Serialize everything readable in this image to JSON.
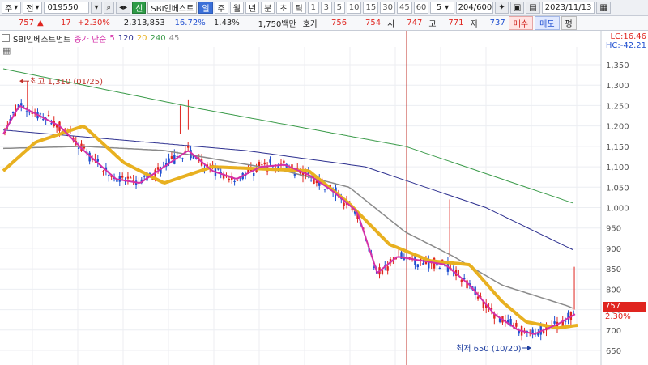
{
  "toolbar": {
    "market_label": "주",
    "prev_label": "전",
    "code": "019550",
    "tag_credit": "신",
    "stock_name": "SBI인베스트",
    "periods": [
      "일",
      "주",
      "월",
      "년",
      "분",
      "초",
      "틱"
    ],
    "period_selected": "일",
    "minute_steps": [
      "1",
      "3",
      "5",
      "10",
      "15",
      "30",
      "45",
      "60"
    ],
    "interval_value": "5",
    "count_value": "204",
    "count_total": "/600",
    "date_value": "2023/11/13"
  },
  "quote": {
    "price": "757",
    "change_arrow": "▲",
    "change": "17",
    "change_pct": "+2.30%",
    "volume": "2,313,853",
    "volume_pct": "16.72%",
    "turnover_pct": "1.43%",
    "amount": "1,750백만",
    "ask_label": "호가",
    "ask1": "756",
    "ask2": "754",
    "open_label": "시",
    "open": "747",
    "high_label": "고",
    "high": "771",
    "low_label": "저",
    "low": "737",
    "buy_label": "매수",
    "sell_label": "매도",
    "eval_label": "평"
  },
  "legend": {
    "name": "SBI인베스트먼트",
    "ma_type": "종가 단순",
    "ma5": "5",
    "ma20": "20",
    "ma120": "120",
    "ma240": "240",
    "ma45": "45"
  },
  "right_info": {
    "lc": "LC:16.46",
    "hc": "HC:-42.21",
    "current_price_tag": "757",
    "current_change_tag": "2.30%"
  },
  "colors": {
    "up": "#e0251f",
    "down": "#1f4fd0",
    "ma5": "#d42fa8",
    "ma20": "#e8b020",
    "ma45": "#8a8a8a",
    "ma120": "#2c2f8f",
    "ma240": "#3b9b4a"
  },
  "chart_data": {
    "type": "candlestick",
    "y_ticks": [
      650,
      700,
      750,
      800,
      850,
      900,
      950,
      1000,
      1050,
      1100,
      1150,
      1200,
      1250,
      1300,
      1350
    ],
    "ylim": [
      630,
      1390
    ],
    "annotations": {
      "high": {
        "label": "최고 1,310 (01/25)",
        "value": 1310
      },
      "low": {
        "label": "최저 650 (10/20)",
        "value": 650
      }
    },
    "series_anchors": {
      "ma240": [
        [
          0,
          1340
        ],
        [
          250,
          1240
        ],
        [
          500,
          1150
        ],
        [
          710,
          1010
        ]
      ],
      "ma120": [
        [
          0,
          1190
        ],
        [
          120,
          1170
        ],
        [
          300,
          1140
        ],
        [
          450,
          1100
        ],
        [
          600,
          1000
        ],
        [
          710,
          895
        ]
      ],
      "ma45": [
        [
          0,
          1145
        ],
        [
          100,
          1150
        ],
        [
          200,
          1140
        ],
        [
          350,
          1090
        ],
        [
          430,
          1050
        ],
        [
          500,
          940
        ],
        [
          560,
          880
        ],
        [
          620,
          810
        ],
        [
          700,
          760
        ],
        [
          710,
          752
        ]
      ],
      "ma20": [
        [
          0,
          1090
        ],
        [
          40,
          1160
        ],
        [
          100,
          1200
        ],
        [
          150,
          1110
        ],
        [
          200,
          1060
        ],
        [
          260,
          1100
        ],
        [
          320,
          1095
        ],
        [
          380,
          1090
        ],
        [
          430,
          1010
        ],
        [
          480,
          910
        ],
        [
          530,
          870
        ],
        [
          580,
          860
        ],
        [
          620,
          770
        ],
        [
          650,
          720
        ],
        [
          690,
          705
        ],
        [
          715,
          712
        ]
      ],
      "ma5": [
        [
          0,
          1180
        ],
        [
          20,
          1250
        ],
        [
          40,
          1230
        ],
        [
          70,
          1200
        ],
        [
          100,
          1140
        ],
        [
          140,
          1070
        ],
        [
          170,
          1060
        ],
        [
          200,
          1100
        ],
        [
          230,
          1140
        ],
        [
          260,
          1090
        ],
        [
          290,
          1070
        ],
        [
          320,
          1100
        ],
        [
          350,
          1105
        ],
        [
          380,
          1080
        ],
        [
          410,
          1040
        ],
        [
          440,
          990
        ],
        [
          465,
          840
        ],
        [
          490,
          880
        ],
        [
          520,
          870
        ],
        [
          550,
          860
        ],
        [
          580,
          810
        ],
        [
          610,
          740
        ],
        [
          640,
          700
        ],
        [
          660,
          690
        ],
        [
          690,
          715
        ],
        [
          712,
          740
        ]
      ]
    }
  }
}
